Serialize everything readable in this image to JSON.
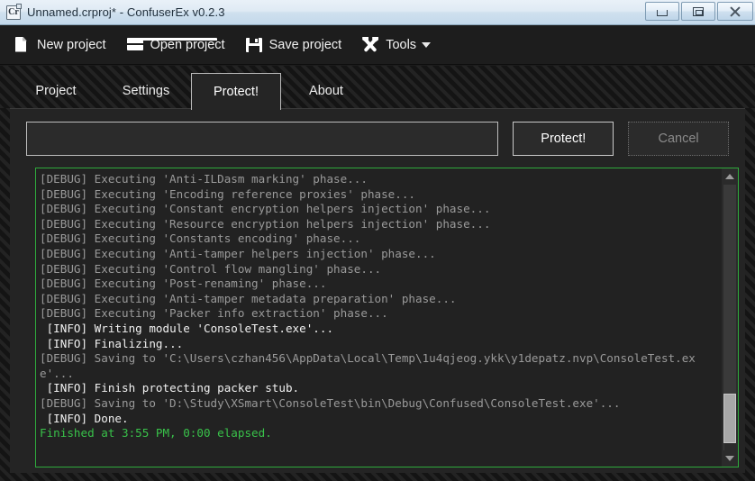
{
  "window": {
    "title": "Unnamed.crproj* - ConfuserEx v0.2.3",
    "app_icon": "confuserex-icon",
    "controls": [
      {
        "name": "minimize-button",
        "icon": "minimize-icon"
      },
      {
        "name": "maximize-button",
        "icon": "maximize-icon"
      },
      {
        "name": "close-button",
        "icon": "close-icon"
      }
    ]
  },
  "toolbar": {
    "new_project": "New project",
    "new_project_icon": "document-icon",
    "open_project": "Open project",
    "open_project_icon": "folder-icon",
    "save_project": "Save project",
    "save_project_icon": "floppy-disk-icon",
    "tools": "Tools",
    "tools_icon": "wrench-hammer-icon",
    "tools_caret": "chevron-down-icon"
  },
  "tabs": [
    {
      "label": "Project",
      "active": false
    },
    {
      "label": "Settings",
      "active": false
    },
    {
      "label": "Protect!",
      "active": true
    },
    {
      "label": "About",
      "active": false
    }
  ],
  "protect_panel": {
    "progress_value": "",
    "protect_button": "Protect!",
    "cancel_button": "Cancel",
    "cancel_enabled": false
  },
  "console": {
    "lines": [
      {
        "level": "debug",
        "text": "[DEBUG] Executing 'Anti-ILDasm marking' phase..."
      },
      {
        "level": "debug",
        "text": "[DEBUG] Executing 'Encoding reference proxies' phase..."
      },
      {
        "level": "debug",
        "text": "[DEBUG] Executing 'Constant encryption helpers injection' phase..."
      },
      {
        "level": "debug",
        "text": "[DEBUG] Executing 'Resource encryption helpers injection' phase..."
      },
      {
        "level": "debug",
        "text": "[DEBUG] Executing 'Constants encoding' phase..."
      },
      {
        "level": "debug",
        "text": "[DEBUG] Executing 'Anti-tamper helpers injection' phase..."
      },
      {
        "level": "debug",
        "text": "[DEBUG] Executing 'Control flow mangling' phase..."
      },
      {
        "level": "debug",
        "text": "[DEBUG] Executing 'Post-renaming' phase..."
      },
      {
        "level": "debug",
        "text": "[DEBUG] Executing 'Anti-tamper metadata preparation' phase..."
      },
      {
        "level": "debug",
        "text": "[DEBUG] Executing 'Packer info extraction' phase..."
      },
      {
        "level": "info",
        "text": " [INFO] Writing module 'ConsoleTest.exe'..."
      },
      {
        "level": "info",
        "text": " [INFO] Finalizing..."
      },
      {
        "level": "debug",
        "text": "[DEBUG] Saving to 'C:\\Users\\czhan456\\AppData\\Local\\Temp\\1u4qjeog.ykk\\y1depatz.nvp\\ConsoleTest.exe'..."
      },
      {
        "level": "info",
        "text": " [INFO] Finish protecting packer stub."
      },
      {
        "level": "debug",
        "text": "[DEBUG] Saving to 'D:\\Study\\XSmart\\ConsoleTest\\bin\\Debug\\Confused\\ConsoleTest.exe'..."
      },
      {
        "level": "info",
        "text": " [INFO] Done."
      },
      {
        "level": "done",
        "text": "Finished at 3:55 PM, 0:00 elapsed."
      }
    ],
    "scrollbar": {
      "up_arrow_icon": "triangle-up-icon",
      "down_arrow_icon": "triangle-down-icon"
    }
  },
  "colors": {
    "console_border": "#2faa3c",
    "done_text": "#39c24a",
    "titlebar": "#cfe0ee",
    "panel_bg": "#242424"
  }
}
